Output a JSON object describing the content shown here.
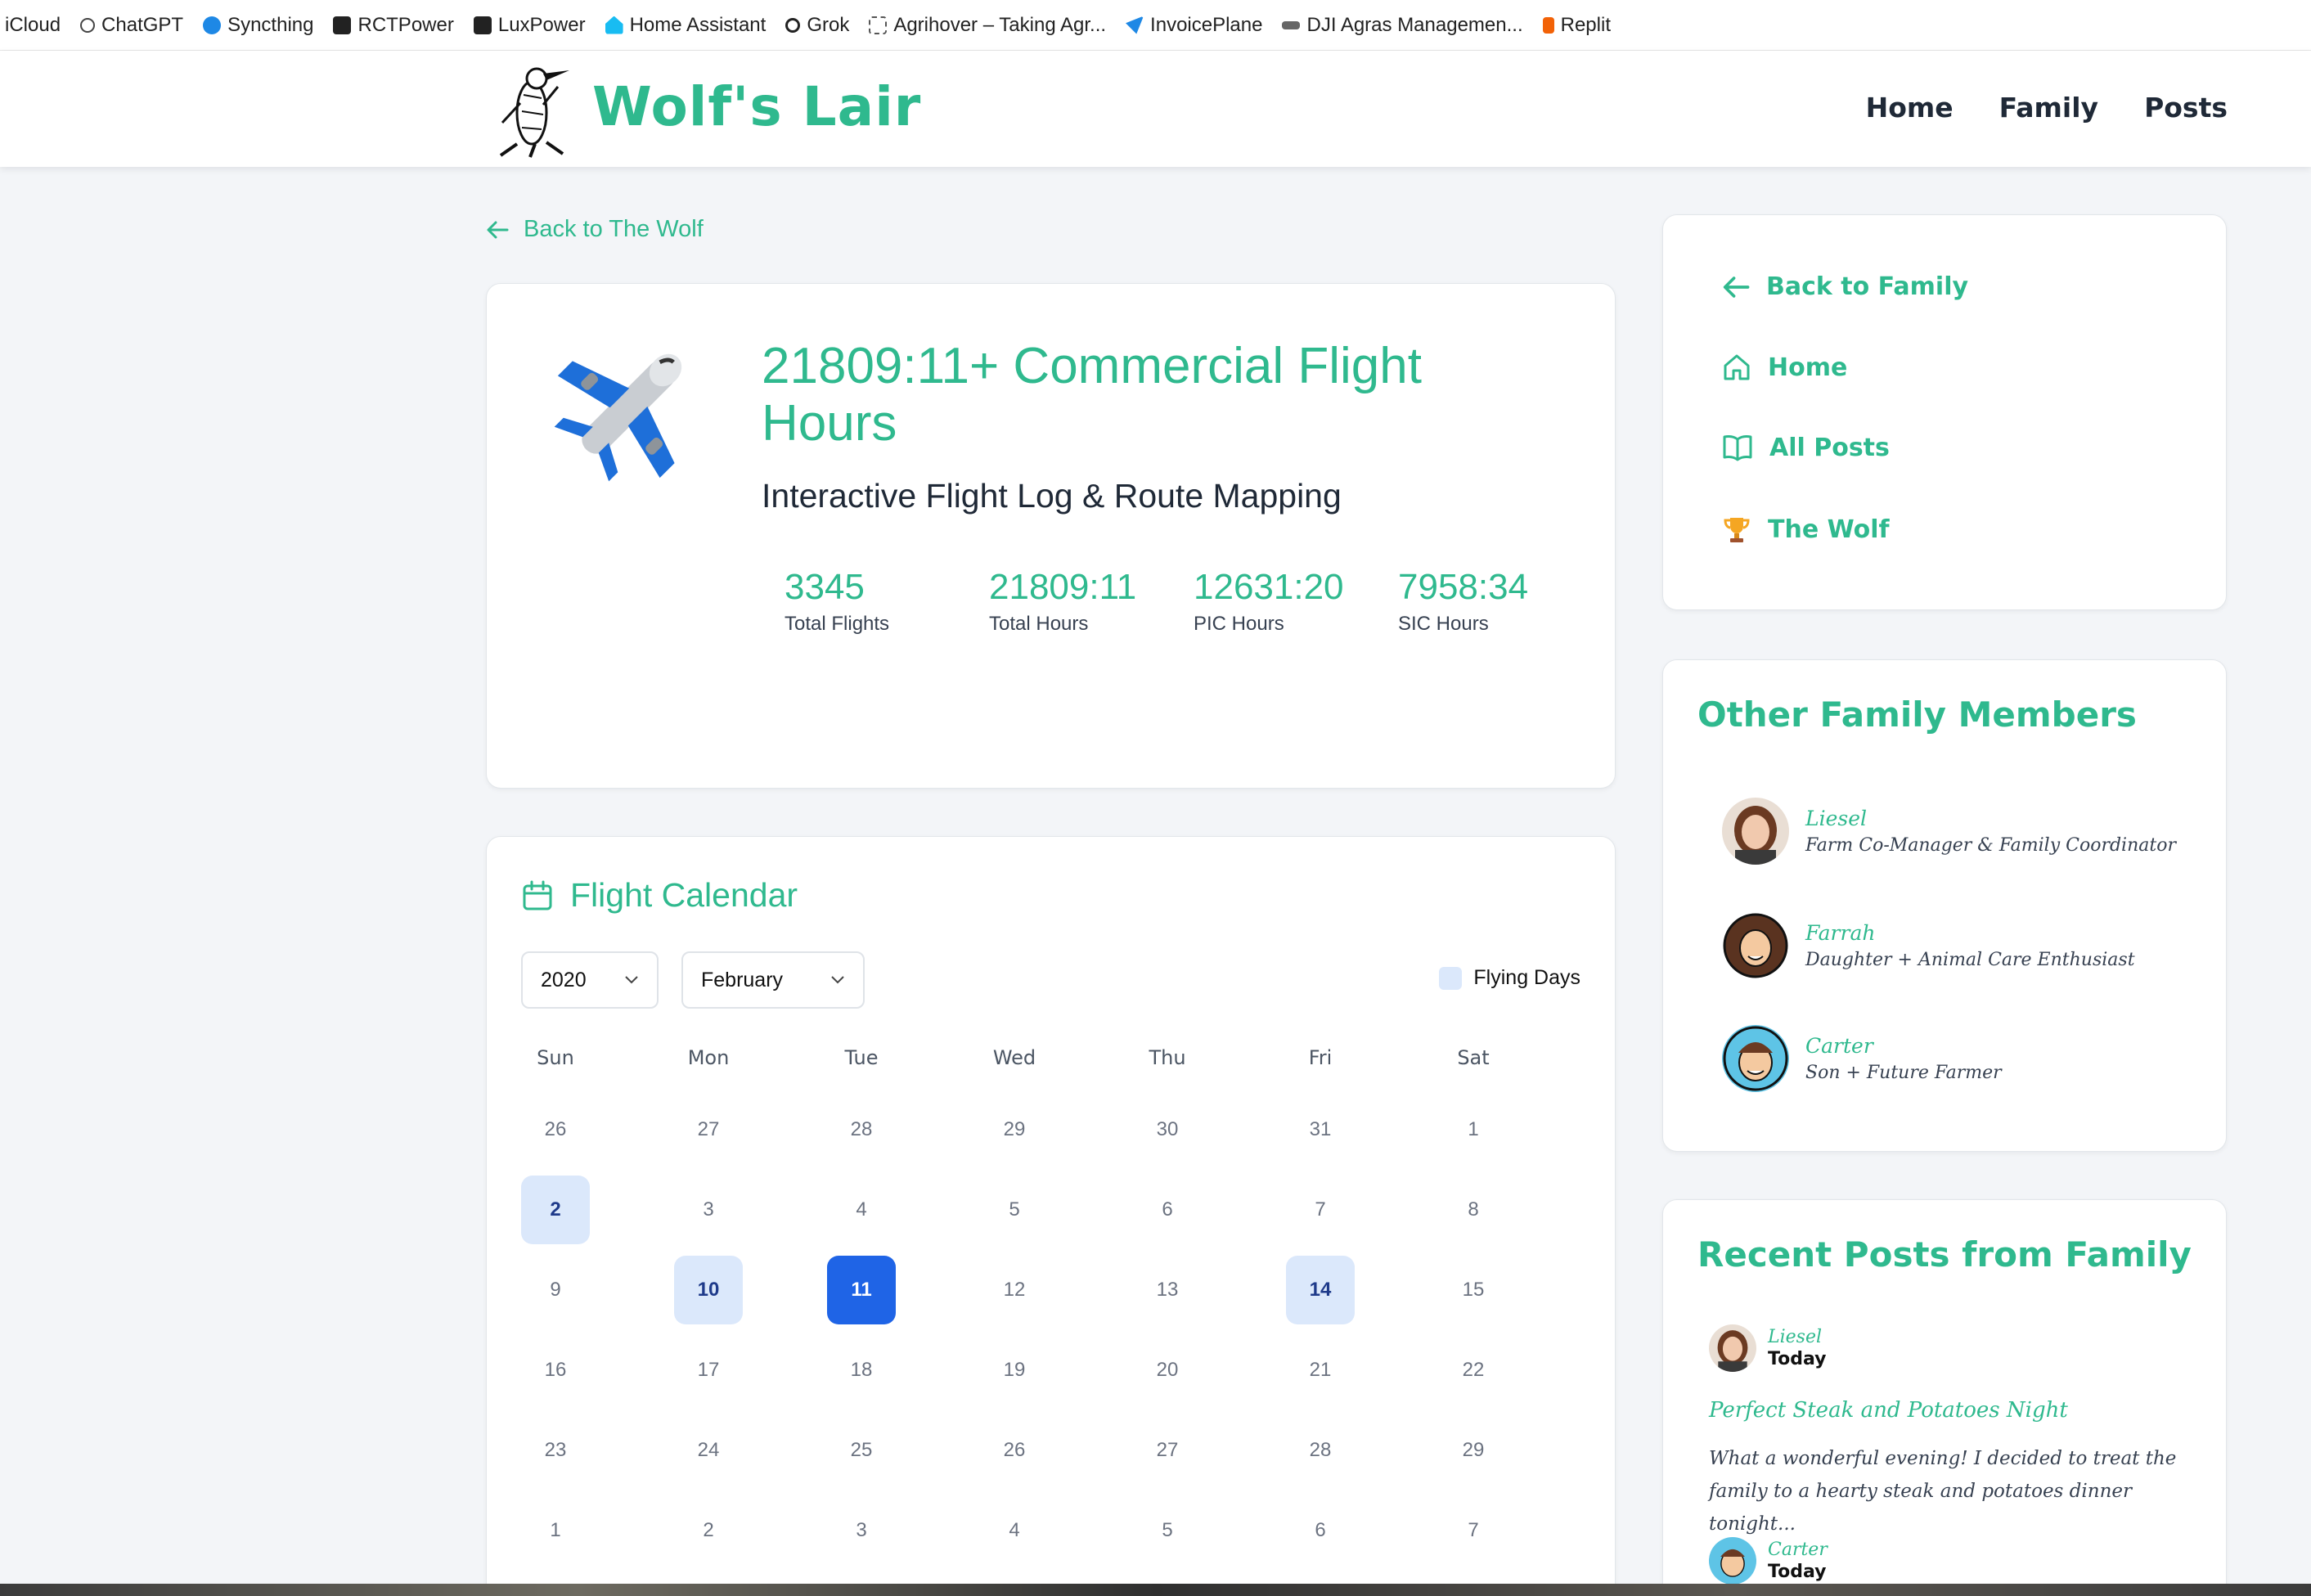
{
  "bookmarks": [
    {
      "label": "iCloud",
      "icon": "icloud-icon",
      "color": ""
    },
    {
      "label": "ChatGPT",
      "icon": "chatgpt-icon",
      "color": "#444444"
    },
    {
      "label": "Syncthing",
      "icon": "syncthing-icon",
      "color": "#1e88e5"
    },
    {
      "label": "RCTPower",
      "icon": "rctpower-icon",
      "color": "#222222"
    },
    {
      "label": "LuxPower",
      "icon": "luxpower-icon",
      "color": "#222222"
    },
    {
      "label": "Home Assistant",
      "icon": "home-assistant-icon",
      "color": "#18bcf2"
    },
    {
      "label": "Grok",
      "icon": "grok-icon",
      "color": "#222222"
    },
    {
      "label": "Agrihover – Taking Agr...",
      "icon": "agrihover-icon",
      "color": "#555555"
    },
    {
      "label": "InvoicePlane",
      "icon": "invoiceplane-icon",
      "color": "#1e88e5"
    },
    {
      "label": "DJI Agras Managemen...",
      "icon": "dji-icon",
      "color": "#555555"
    },
    {
      "label": "Replit",
      "icon": "replit-icon",
      "color": "#f26207"
    }
  ],
  "header": {
    "logo_text": "Wolf's Lair",
    "nav": [
      "Home",
      "Family",
      "Posts"
    ]
  },
  "back_link": "Back to The Wolf",
  "hero": {
    "title": "21809:11+ Commercial Flight Hours",
    "subtitle": "Interactive Flight Log & Route Mapping",
    "stats": [
      {
        "value": "3345",
        "label": "Total Flights"
      },
      {
        "value": "21809:11",
        "label": "Total Hours"
      },
      {
        "value": "12631:20",
        "label": "PIC Hours"
      },
      {
        "value": "7958:34",
        "label": "SIC Hours"
      }
    ]
  },
  "calendar": {
    "title": "Flight Calendar",
    "year": "2020",
    "month": "February",
    "legend": "Flying Days",
    "weekdays": [
      "Sun",
      "Mon",
      "Tue",
      "Wed",
      "Thu",
      "Fri",
      "Sat"
    ],
    "weeks": [
      [
        "26",
        "27",
        "28",
        "29",
        "30",
        "31",
        "1"
      ],
      [
        "2",
        "3",
        "4",
        "5",
        "6",
        "7",
        "8"
      ],
      [
        "9",
        "10",
        "11",
        "12",
        "13",
        "14",
        "15"
      ],
      [
        "16",
        "17",
        "18",
        "19",
        "20",
        "21",
        "22"
      ],
      [
        "23",
        "24",
        "25",
        "26",
        "27",
        "28",
        "29"
      ],
      [
        "1",
        "2",
        "3",
        "4",
        "5",
        "6",
        "7"
      ]
    ],
    "flying_days": [
      "2",
      "10",
      "14"
    ],
    "selected_day": "11"
  },
  "sidebar": {
    "nav": [
      {
        "label": "Back to Family",
        "icon": "arrow-left-icon"
      },
      {
        "label": "Home",
        "icon": "home-icon"
      },
      {
        "label": "All Posts",
        "icon": "book-icon"
      },
      {
        "label": "The Wolf",
        "icon": "trophy-icon"
      }
    ],
    "family_title": "Other Family Members",
    "members": [
      {
        "name": "Liesel",
        "role": "Farm Co-Manager & Family Coordinator"
      },
      {
        "name": "Farrah",
        "role": "Daughter + Animal Care Enthusiast"
      },
      {
        "name": "Carter",
        "role": "Son + Future Farmer"
      }
    ],
    "recent_title": "Recent Posts from Family",
    "posts": [
      {
        "author": "Liesel",
        "date": "Today",
        "title": "Perfect Steak and Potatoes Night",
        "excerpt": "What a wonderful evening! I decided to treat the family to a hearty steak and potatoes dinner tonight..."
      },
      {
        "author": "Carter",
        "date": "Today"
      }
    ]
  },
  "colors": {
    "accent": "#2fb98e",
    "flying": "#dbe8fb",
    "selected": "#1f64e6"
  }
}
